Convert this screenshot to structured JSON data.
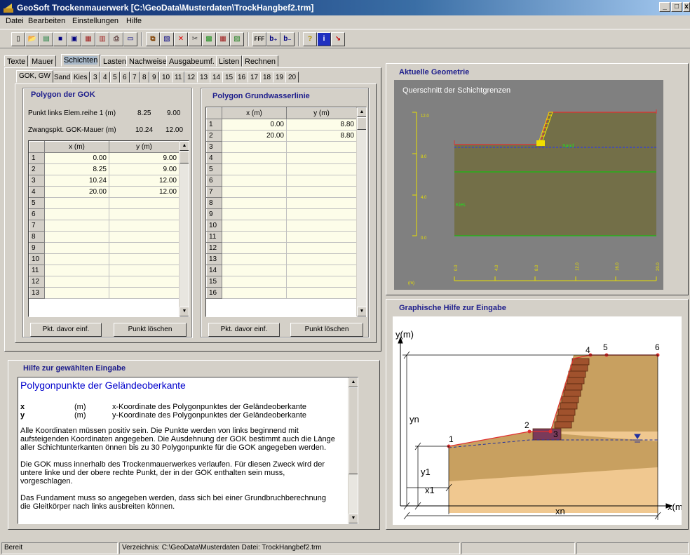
{
  "window": {
    "title": "GeoSoft Trockenmauerwerk [C:\\GeoData\\Musterdaten\\TrockHangbef2.trm]",
    "buttons": [
      "_",
      "□",
      "x"
    ]
  },
  "menu": [
    {
      "label": "Datei"
    },
    {
      "label": "Bearbeiten"
    },
    {
      "label": "Einstellungen"
    },
    {
      "label": "Hilfe"
    }
  ],
  "toolbar": [
    {
      "icon": "new-file-icon",
      "glyph": "▯"
    },
    {
      "icon": "open-file-icon",
      "glyph": "📂"
    },
    {
      "icon": "open-folder-icon",
      "glyph": "▤"
    },
    {
      "icon": "save-icon",
      "glyph": "■"
    },
    {
      "icon": "save-as-icon",
      "glyph": "▣"
    },
    {
      "icon": "print-preview-icon",
      "glyph": "▦"
    },
    {
      "icon": "export-icon",
      "glyph": "▥"
    },
    {
      "icon": "print-icon",
      "glyph": "⎙"
    },
    {
      "icon": "screen-icon",
      "glyph": "▭"
    },
    {
      "icon": "copy-icon",
      "glyph": "⧉"
    },
    {
      "icon": "paste-icon",
      "glyph": "▧"
    },
    {
      "icon": "delete-icon",
      "glyph": "✕"
    },
    {
      "icon": "cut-icon",
      "glyph": "✂"
    },
    {
      "icon": "chart-icon",
      "glyph": "▩"
    },
    {
      "icon": "table-icon",
      "glyph": "▦"
    },
    {
      "icon": "calc-icon",
      "glyph": "▨"
    },
    {
      "icon": "font-icon",
      "glyph": "FFF"
    },
    {
      "icon": "sub-b-plus-icon",
      "glyph": "b₊"
    },
    {
      "icon": "sub-b-minus-icon",
      "glyph": "b₋"
    },
    {
      "icon": "help-icon",
      "glyph": "?"
    },
    {
      "icon": "info-icon",
      "glyph": "i"
    },
    {
      "icon": "exit-icon",
      "glyph": "↘"
    }
  ],
  "main_tabs": [
    "Texte",
    "Mauer",
    "Schichten",
    "Lasten",
    "Nachweise",
    "Ausgabeumf.",
    "Listen",
    "Rechnen"
  ],
  "main_tab_active": "Schichten",
  "sub_tabs": [
    "GOK, GW",
    "Sand",
    "Kies",
    "3",
    "4",
    "5",
    "6",
    "7",
    "8",
    "9",
    "10",
    "11",
    "12",
    "13",
    "14",
    "15",
    "16",
    "17",
    "18",
    "19",
    "20"
  ],
  "gok": {
    "title": "Polygon der GOK",
    "info1_label": "Punkt links Elem.reihe 1 (m)",
    "info1_v1": "8.25",
    "info1_v2": "9.00",
    "info2_label": "Zwangspkt. GOK-Mauer (m)",
    "info2_v1": "10.24",
    "info2_v2": "12.00",
    "col_x": "x (m)",
    "col_y": "y (m)",
    "rows": [
      {
        "n": "1",
        "x": "0.00",
        "y": "9.00"
      },
      {
        "n": "2",
        "x": "8.25",
        "y": "9.00"
      },
      {
        "n": "3",
        "x": "10.24",
        "y": "12.00"
      },
      {
        "n": "4",
        "x": "20.00",
        "y": "12.00"
      },
      {
        "n": "5",
        "x": "",
        "y": ""
      },
      {
        "n": "6",
        "x": "",
        "y": ""
      },
      {
        "n": "7",
        "x": "",
        "y": ""
      },
      {
        "n": "8",
        "x": "",
        "y": ""
      },
      {
        "n": "9",
        "x": "",
        "y": ""
      },
      {
        "n": "10",
        "x": "",
        "y": ""
      },
      {
        "n": "11",
        "x": "",
        "y": ""
      },
      {
        "n": "12",
        "x": "",
        "y": ""
      },
      {
        "n": "13",
        "x": "",
        "y": ""
      }
    ],
    "btn_insert": "Pkt. davor einf.",
    "btn_delete": "Punkt löschen"
  },
  "gw": {
    "title": "Polygon Grundwasserlinie",
    "col_x": "x (m)",
    "col_y": "y (m)",
    "rows": [
      {
        "n": "1",
        "x": "0.00",
        "y": "8.80"
      },
      {
        "n": "2",
        "x": "20.00",
        "y": "8.80"
      },
      {
        "n": "3",
        "x": "",
        "y": ""
      },
      {
        "n": "4",
        "x": "",
        "y": ""
      },
      {
        "n": "5",
        "x": "",
        "y": ""
      },
      {
        "n": "6",
        "x": "",
        "y": ""
      },
      {
        "n": "7",
        "x": "",
        "y": ""
      },
      {
        "n": "8",
        "x": "",
        "y": ""
      },
      {
        "n": "9",
        "x": "",
        "y": ""
      },
      {
        "n": "10",
        "x": "",
        "y": ""
      },
      {
        "n": "11",
        "x": "",
        "y": ""
      },
      {
        "n": "12",
        "x": "",
        "y": ""
      },
      {
        "n": "13",
        "x": "",
        "y": ""
      },
      {
        "n": "14",
        "x": "",
        "y": ""
      },
      {
        "n": "15",
        "x": "",
        "y": ""
      },
      {
        "n": "16",
        "x": "",
        "y": ""
      }
    ],
    "btn_insert": "Pkt. davor einf.",
    "btn_delete": "Punkt löschen"
  },
  "help": {
    "group_title": "Hilfe zur gewählten Eingabe",
    "title": "Polygonpunkte der Geländeoberkante",
    "def_x_sym": "x",
    "def_x_unit": "(m)",
    "def_x_text": "x-Koordinate des Polygonpunktes der Geländeoberkante",
    "def_y_sym": "y",
    "def_y_unit": "(m)",
    "def_y_text": "y-Koordinate des Polygonpunktes der Geländeoberkante",
    "lines": [
      "Alle Koordinaten müssen positiv sein. Die Punkte werden von links beginnend mit",
      "aufsteigenden Koordinaten angegeben. Die Ausdehnung der GOK bestimmt auch die Länge",
      "aller Schichtunterkanten önnen bis zu 30 Polygonpunkte für die GOK angegeben werden.",
      "",
      "Die GOK muss innerhalb des Trockenmauerwerkes verlaufen. Für diesen Zweck wird der",
      "untere linke und der obere rechte Punkt, der in der GOK enthalten sein muss,",
      "vorgeschlagen.",
      "",
      "Das Fundament muss so angegeben werden, dass sich bei einer Grundbruchberechnung",
      "die Gleitkörper nach links ausbreiten können."
    ]
  },
  "geometry": {
    "group_title": "Aktuelle Geometrie",
    "plot_title": "Querschnitt der Schichtgrenzen",
    "layer_sand": "Sand",
    "layer_kies": "Kies",
    "y_ticks": [
      "12.0",
      "8.0",
      "4.0",
      "0.0"
    ],
    "x_ticks": [
      "0.0",
      "4.0",
      "8.0",
      "12.0",
      "16.0",
      "20.0"
    ],
    "x_unit": "(m)",
    "colors": {
      "bg": "#808080",
      "soil": "#736f48",
      "gok": "#e03030",
      "gw": "#00c000",
      "axis": "#e8e000",
      "kies_line": "#20c020"
    }
  },
  "graphic": {
    "group_title": "Graphische Hilfe zur Eingabe",
    "ylabel": "y(m)",
    "xlabel": "x(m)",
    "points": [
      "1",
      "2",
      "3",
      "4",
      "5",
      "6"
    ],
    "lbl_yn": "yn",
    "lbl_y1": "y1",
    "lbl_x1": "x1",
    "lbl_xn": "xn"
  },
  "status": {
    "left": "Bereit",
    "mid": "Verzeichnis: C:\\GeoData\\Musterdaten   Datei: TrockHangbef2.trm"
  }
}
